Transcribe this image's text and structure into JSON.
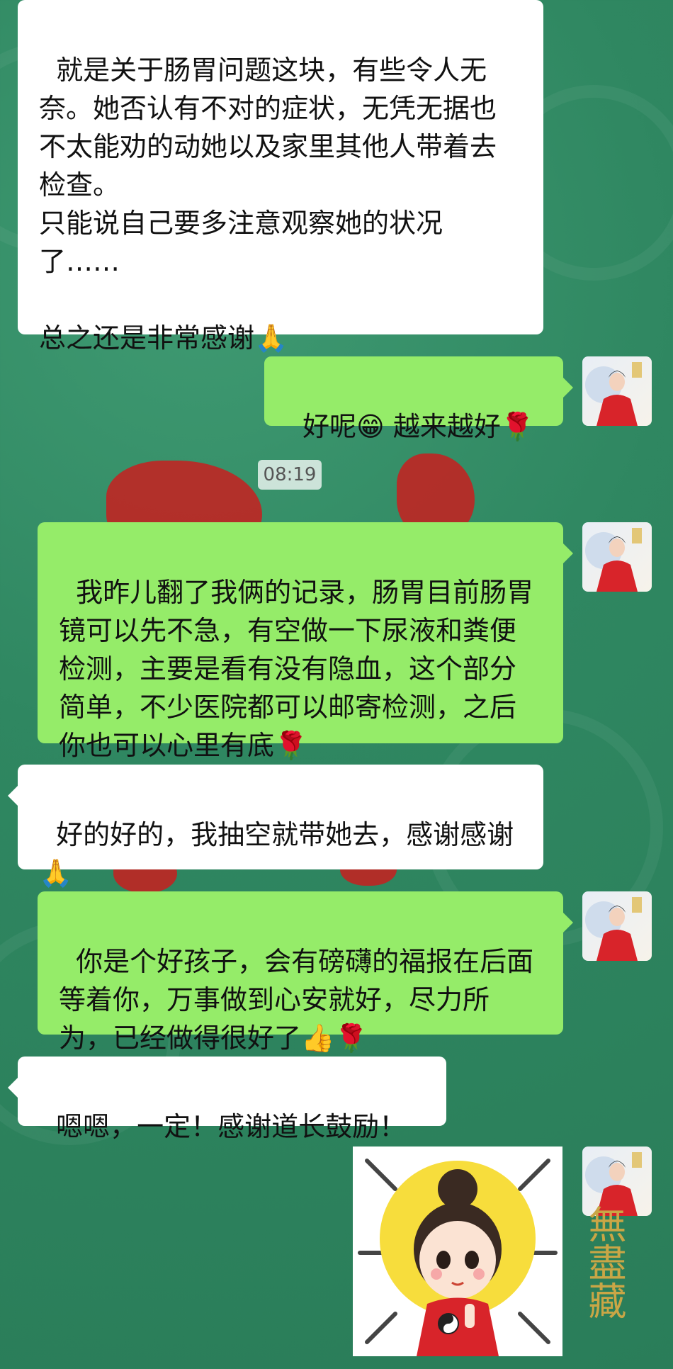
{
  "messages": [
    {
      "side": "left",
      "text": "就是关于肠胃问题这块，有些令人无奈。她否认有不对的症状，无凭无据也不太能劝的动她以及家里其他人带着去检查。\n只能说自己要多注意观察她的状况了……\n\n总之还是非常感谢🙏"
    },
    {
      "side": "right",
      "text": "好呢😁 越来越好🌹"
    },
    {
      "side": "right",
      "text": "我昨儿翻了我俩的记录，肠胃目前肠胃镜可以先不急，有空做一下尿液和粪便检测，主要是看有没有隐血，这个部分简单，不少医院都可以邮寄检测，之后你也可以心里有底🌹"
    },
    {
      "side": "left",
      "text": "好的好的，我抽空就带她去，感谢感谢🙏"
    },
    {
      "side": "right",
      "text": "你是个好孩子，会有磅礴的福报在后面等着你，万事做到心安就好，尽力所为，已经做得很好了👍🌹"
    },
    {
      "side": "left",
      "text": "嗯嗯，一定！感谢道长鼓励！"
    }
  ],
  "timestamp": "08:19",
  "sticker": {
    "name": "taoist-girl-sticker"
  },
  "watermark_text": "無盡藏"
}
